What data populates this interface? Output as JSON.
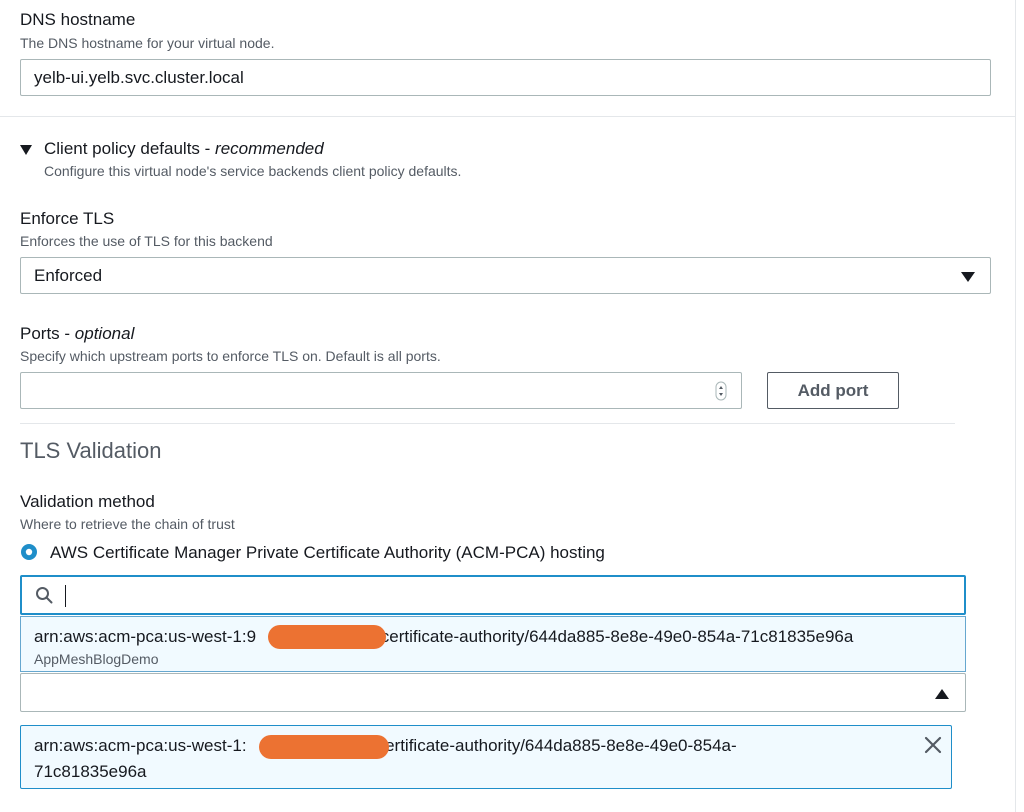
{
  "dns": {
    "label": "DNS hostname",
    "description": "The DNS hostname for your virtual node.",
    "value": "yelb-ui.yelb.svc.cluster.local"
  },
  "client_policy": {
    "title": "Client policy defaults - ",
    "title_suffix": "recommended",
    "description": "Configure this virtual node's service backends client policy defaults."
  },
  "enforce_tls": {
    "label": "Enforce TLS",
    "description": "Enforces the use of TLS for this backend",
    "selected": "Enforced"
  },
  "ports": {
    "label": "Ports - ",
    "label_suffix": "optional",
    "description": "Specify which upstream ports to enforce TLS on. Default is all ports.",
    "value": "",
    "add_button": "Add port"
  },
  "tls_validation": {
    "heading": "TLS Validation",
    "method_label": "Validation method",
    "method_description": "Where to retrieve the chain of trust",
    "radio_label": "AWS Certificate Manager Private Certificate Authority (ACM-PCA) hosting",
    "search_value": "",
    "option": {
      "arn_prefix": "arn:aws:acm-pca:us-west-1:9",
      "arn_suffix": ":certificate-authority/644da885-8e8e-49e0-854a-71c81835e96a",
      "name": "AppMeshBlogDemo"
    },
    "selected": {
      "arn_prefix": "arn:aws:acm-pca:us-west-1:",
      "arn_suffix": "certificate-authority/644da885-8e8e-49e0-854a-",
      "arn_line2": "71c81835e96a"
    }
  },
  "colors": {
    "accent": "#1f8ec9",
    "redaction": "#ec7232"
  },
  "icons": {
    "expand": "caret-down-icon",
    "dropdown": "caret-down-icon",
    "search": "search-icon",
    "collapse": "caret-up-icon",
    "remove": "close-icon",
    "stepper": "spinner-icon"
  }
}
